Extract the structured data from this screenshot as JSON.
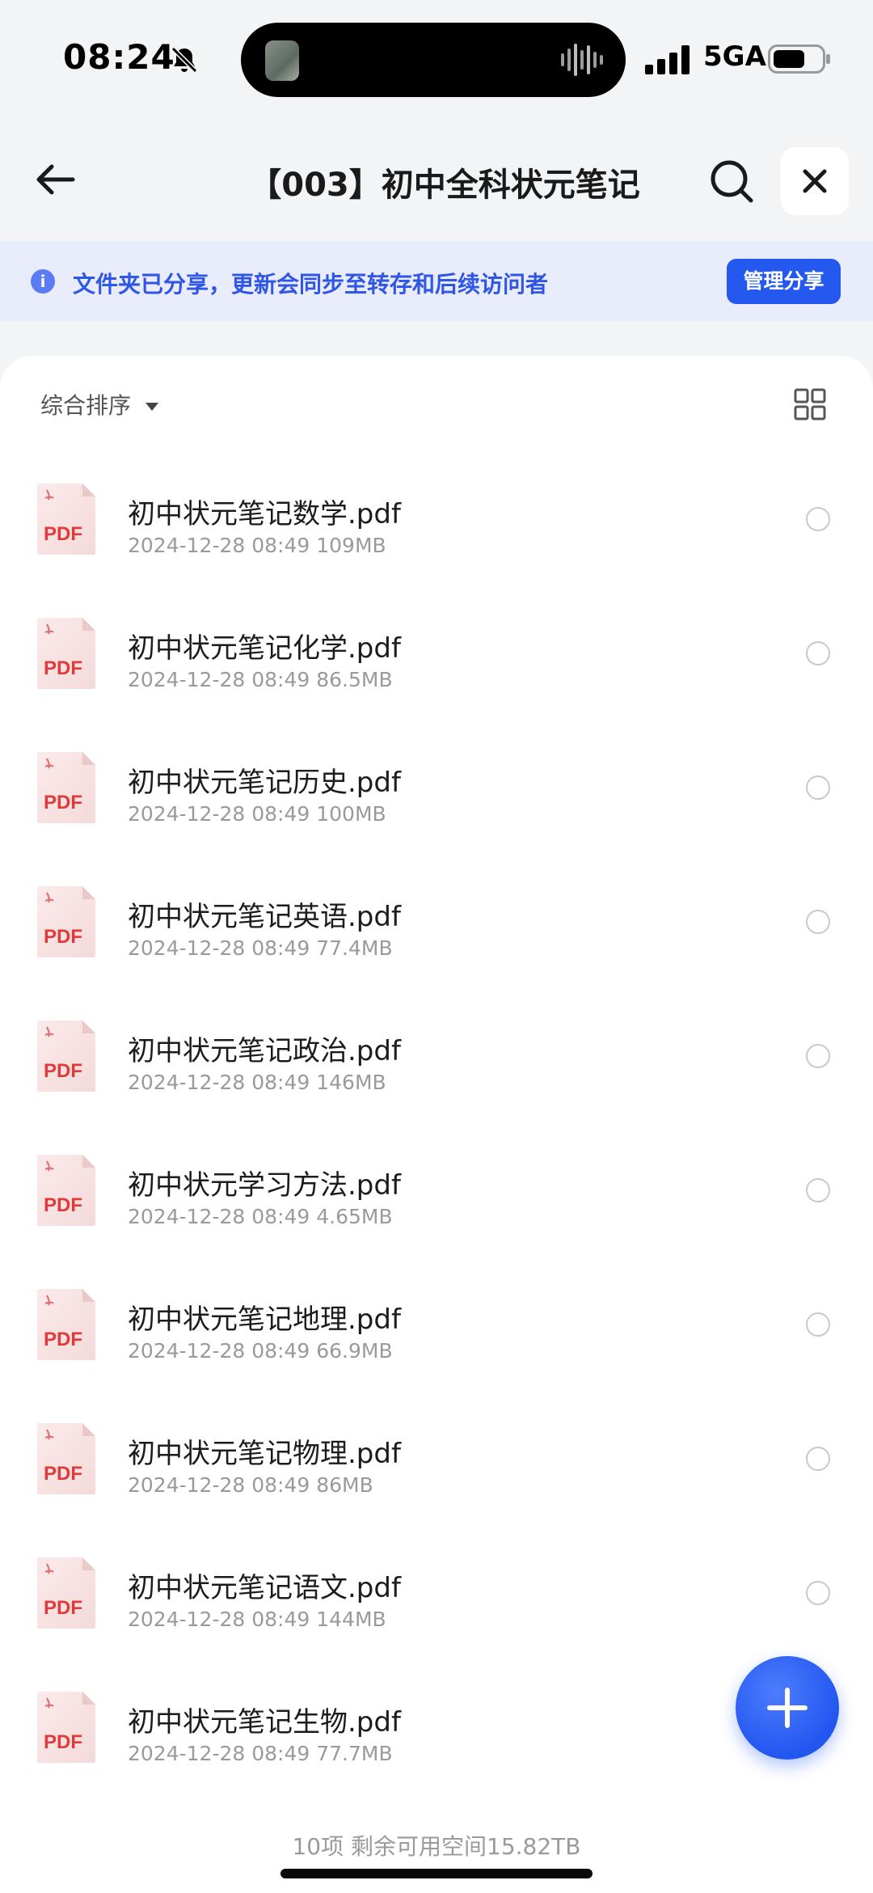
{
  "status_bar": {
    "time": "08:24",
    "network": "5GA"
  },
  "header": {
    "title": "【003】初中全科状元笔记"
  },
  "banner": {
    "message": "文件夹已分享，更新会同步至转存和后续访问者",
    "manage_label": "管理分享"
  },
  "toolbar": {
    "sort_label": "综合排序"
  },
  "files": [
    {
      "name": "初中状元笔记数学.pdf",
      "meta": "2024-12-28 08:49  109MB"
    },
    {
      "name": "初中状元笔记化学.pdf",
      "meta": "2024-12-28 08:49  86.5MB"
    },
    {
      "name": "初中状元笔记历史.pdf",
      "meta": "2024-12-28 08:49  100MB"
    },
    {
      "name": "初中状元笔记英语.pdf",
      "meta": "2024-12-28 08:49  77.4MB"
    },
    {
      "name": "初中状元笔记政治.pdf",
      "meta": "2024-12-28 08:49  146MB"
    },
    {
      "name": "初中状元学习方法.pdf",
      "meta": "2024-12-28 08:49  4.65MB"
    },
    {
      "name": "初中状元笔记地理.pdf",
      "meta": "2024-12-28 08:49  66.9MB"
    },
    {
      "name": "初中状元笔记物理.pdf",
      "meta": "2024-12-28 08:49  86MB"
    },
    {
      "name": "初中状元笔记语文.pdf",
      "meta": "2024-12-28 08:49  144MB"
    },
    {
      "name": "初中状元笔记生物.pdf",
      "meta": "2024-12-28 08:49  77.7MB"
    }
  ],
  "pdf_badge": "PDF",
  "footer": {
    "summary": "10项 剩余可用空间15.82TB"
  },
  "colors": {
    "accent": "#2458ee",
    "banner_bg": "#e9ecfb",
    "pdf_red": "#e03a3a"
  }
}
